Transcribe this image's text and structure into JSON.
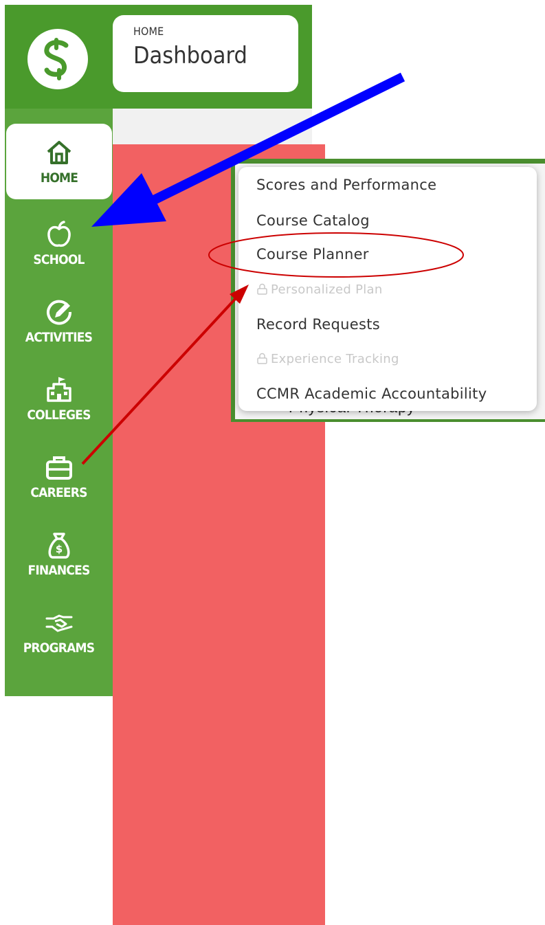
{
  "header": {
    "eyebrow": "HOME",
    "title": "Dashboard"
  },
  "sidebar": {
    "items": [
      {
        "label": "HOME",
        "icon": "home-icon",
        "active": true
      },
      {
        "label": "SCHOOL",
        "icon": "apple-icon"
      },
      {
        "label": "ACTIVITIES",
        "icon": "pencil-circle-icon"
      },
      {
        "label": "COLLEGES",
        "icon": "college-building-icon"
      },
      {
        "label": "CAREERS",
        "icon": "briefcase-icon"
      },
      {
        "label": "FINANCES",
        "icon": "money-bag-icon"
      },
      {
        "label": "PROGRAMS",
        "icon": "handshake-icon"
      }
    ]
  },
  "dropdown": {
    "items": [
      {
        "label": "Scores and Performance",
        "disabled": false
      },
      {
        "label": "Course Catalog",
        "disabled": false
      },
      {
        "label": "Course Planner",
        "disabled": false,
        "highlighted": true
      },
      {
        "label": "Personalized Plan",
        "disabled": true,
        "icon": "lock-icon"
      },
      {
        "label": "Record Requests",
        "disabled": false
      },
      {
        "label": "Experience Tracking",
        "disabled": true,
        "icon": "lock-icon"
      },
      {
        "label": "CCMR Academic Accountability",
        "disabled": false
      }
    ]
  },
  "background": {
    "partial_text": "Physical Therapy"
  },
  "colors": {
    "sidebar_green": "#5ba43d",
    "header_green": "#4a9a2c",
    "overlay_red": "#f26162",
    "blue_arrow": "#0000ff",
    "red_arrow": "#cc0000"
  }
}
